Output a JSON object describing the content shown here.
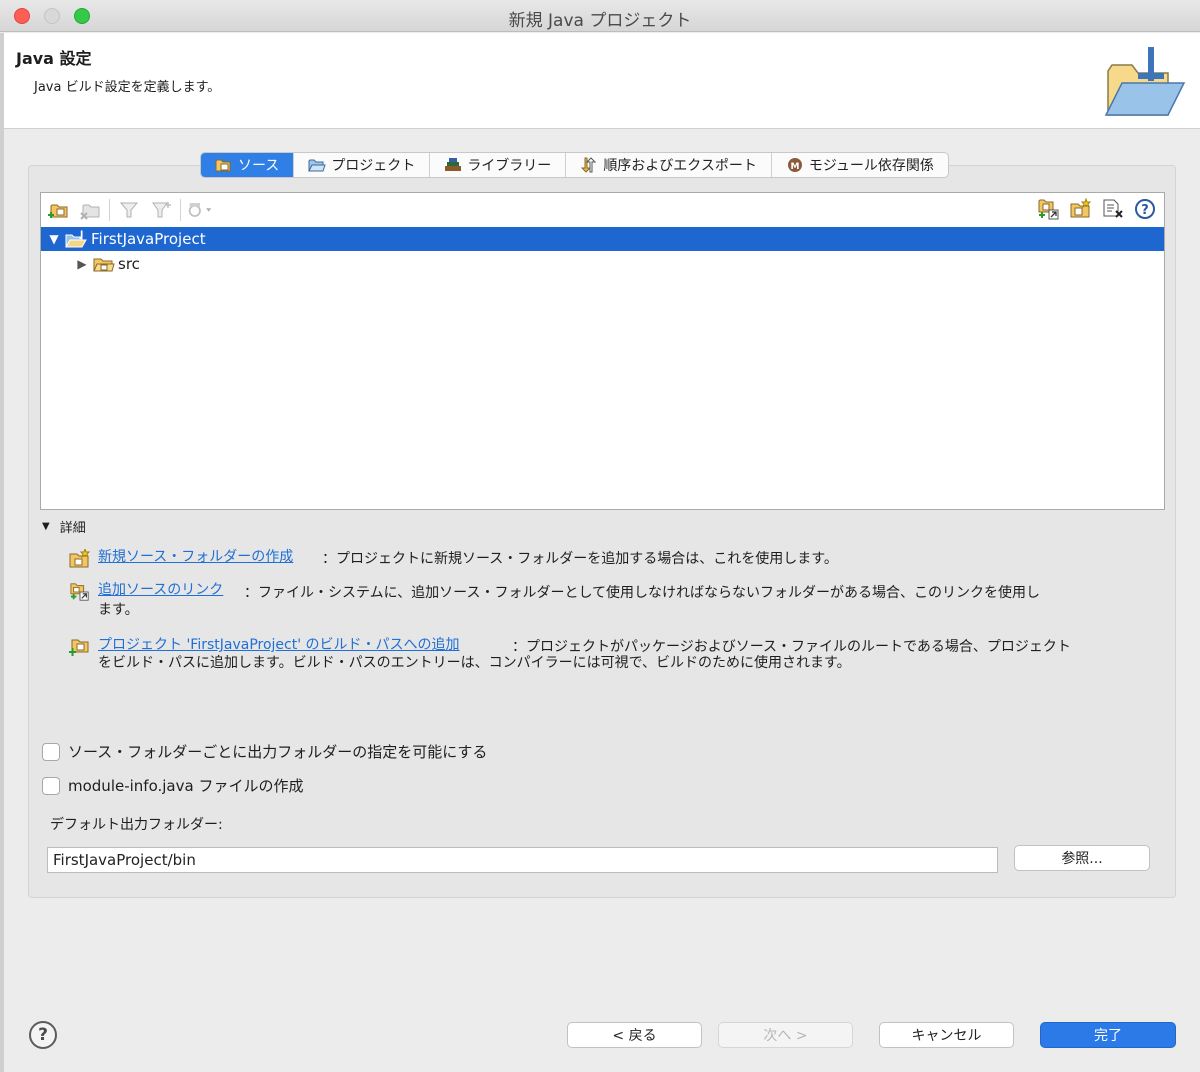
{
  "window": {
    "title": "新規 Java プロジェクト"
  },
  "header": {
    "title": "Java 設定",
    "description": "Java ビルド設定を定義します。"
  },
  "tabs": [
    {
      "label": "ソース",
      "icon": "source-folder-icon",
      "active": true
    },
    {
      "label": "プロジェクト",
      "icon": "project-icon",
      "active": false
    },
    {
      "label": "ライブラリー",
      "icon": "library-icon",
      "active": false
    },
    {
      "label": "順序およびエクスポート",
      "icon": "order-export-icon",
      "active": false
    },
    {
      "label": "モジュール依存関係",
      "icon": "module-icon",
      "active": false
    }
  ],
  "tree": {
    "items": [
      {
        "label": "FirstJavaProject",
        "expanded": true,
        "selected": true,
        "icon": "java-project-icon"
      },
      {
        "label": "src",
        "expanded": false,
        "selected": false,
        "icon": "source-folder-icon"
      }
    ]
  },
  "details": {
    "label": "詳細",
    "items": [
      {
        "link": "新規ソース・フォルダーの作成",
        "text": "：プロジェクトに新規ソース・フォルダーを追加する場合は、これを使用します。",
        "icon": "new-source-folder-icon"
      },
      {
        "link": "追加ソースのリンク",
        "text": "：ファイル・システムに、追加ソース・フォルダーとして使用しなければならないフォルダーがある場合、このリンクを使用し",
        "text2": "ます。",
        "icon": "link-source-icon"
      },
      {
        "link": "プロジェクト 'FirstJavaProject' のビルド・パスへの追加",
        "text": "：プロジェクトがパッケージおよびソース・ファイルのルートである場合、プロジェクト",
        "text2": "をビルド・パスに追加します。ビルド・パスのエントリーは、コンパイラーには可視で、ビルドのために使用されます。",
        "icon": "add-build-path-icon"
      }
    ]
  },
  "options": {
    "per_folder_output": {
      "label": "ソース・フォルダーごとに出力フォルダーの指定を可能にする",
      "checked": false
    },
    "module_info": {
      "label": "module-info.java ファイルの作成",
      "checked": false
    }
  },
  "output": {
    "label": "デフォルト出力フォルダー:",
    "value": "FirstJavaProject/bin",
    "browse_label": "参照..."
  },
  "footer": {
    "help": "?",
    "back_label": "< 戻る",
    "next_label": "次へ >",
    "cancel_label": "キャンセル",
    "finish_label": "完了"
  },
  "colors": {
    "accent": "#2b7ae8",
    "selection": "#1e66d0",
    "link": "#1f6fd6"
  }
}
